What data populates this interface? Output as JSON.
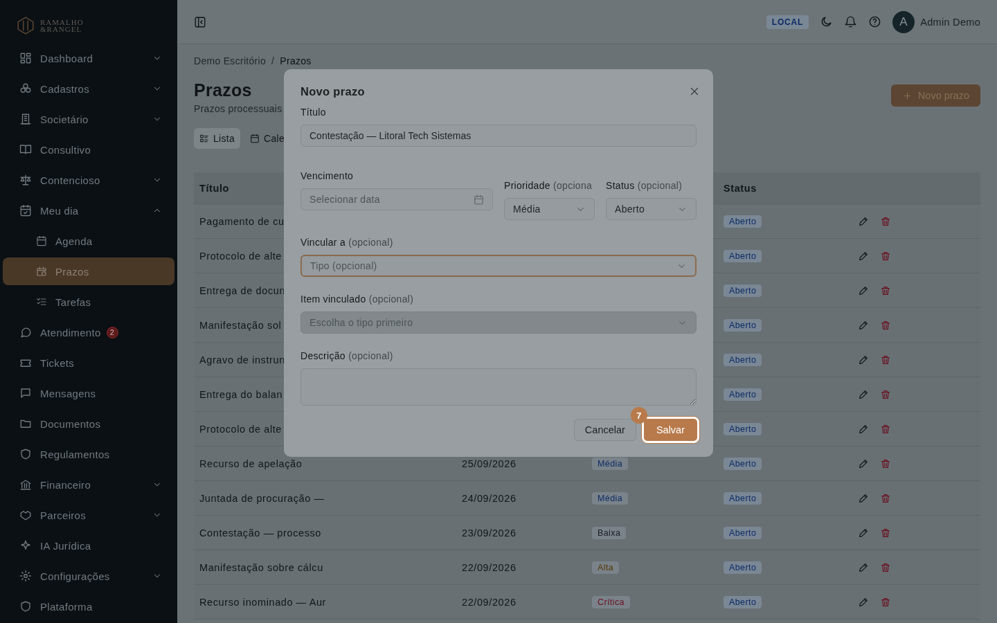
{
  "sidebar": {
    "logo": {
      "line_1": "RAMALHO",
      "line_2": "&RANGEL"
    },
    "items": [
      {
        "label": "Dashboard",
        "expandable": true,
        "expanded": false,
        "selected": false
      },
      {
        "label": "Cadastros",
        "expandable": true,
        "expanded": false,
        "selected": false
      },
      {
        "label": "Societário",
        "expandable": true,
        "expanded": false,
        "selected": false
      },
      {
        "label": "Consultivo",
        "expandable": false,
        "selected": false
      },
      {
        "label": "Contencioso",
        "expandable": true,
        "expanded": false,
        "selected": false
      },
      {
        "label": "Meu dia",
        "expandable": true,
        "expanded": true,
        "selected": false,
        "children": [
          {
            "label": "Agenda",
            "selected": false
          },
          {
            "label": "Prazos",
            "selected": true
          },
          {
            "label": "Tarefas",
            "selected": false
          }
        ]
      },
      {
        "label": "Atendimento",
        "expandable": false,
        "selected": false,
        "badge": "2"
      },
      {
        "label": "Tickets",
        "expandable": false,
        "selected": false
      },
      {
        "label": "Mensagens",
        "expandable": false,
        "selected": false
      },
      {
        "label": "Documentos",
        "expandable": false,
        "selected": false
      },
      {
        "label": "Regulamentos",
        "expandable": false,
        "selected": false
      },
      {
        "label": "Financeiro",
        "expandable": true,
        "expanded": false,
        "selected": false
      },
      {
        "label": "Parceiros",
        "expandable": true,
        "expanded": false,
        "selected": false
      },
      {
        "label": "IA Jurídica",
        "expandable": false,
        "selected": false
      },
      {
        "label": "Configurações",
        "expandable": true,
        "expanded": false,
        "selected": false
      },
      {
        "label": "Plataforma",
        "expandable": false,
        "selected": false
      }
    ]
  },
  "header": {
    "environment": "LOCAL",
    "avatar": "A",
    "user": "Admin Demo"
  },
  "breadcrumb": [
    "Demo Escritório",
    "/",
    "Prazos"
  ],
  "page": {
    "title": "Prazos",
    "subtitle": "Prazos processuais",
    "new_button": "Novo prazo"
  },
  "view_tabs": [
    {
      "label": "Lista",
      "selected": true
    },
    {
      "label": "Cale",
      "selected": false
    }
  ],
  "table": {
    "columns": [
      {
        "label": "Título"
      },
      {
        "label": "Status"
      }
    ],
    "rows": [
      {
        "title": "Pagamento de cu",
        "status": "Aberto"
      },
      {
        "title": "Protocolo de alte",
        "status": "Aberto"
      },
      {
        "title": "Entrega de docun",
        "status": "Aberto"
      },
      {
        "title": "Manifestação sol",
        "status": "Aberto"
      },
      {
        "title": "Agravo de instrun",
        "status": "Aberto"
      },
      {
        "title": "Entrega do balan",
        "status": "Aberto"
      },
      {
        "title": "Protocolo de alte",
        "status": "Aberto"
      },
      {
        "title": "Recurso de apelação",
        "date": "25/09/2026",
        "priority": {
          "label": "Média",
          "color": "#0b2a66"
        },
        "status": "Aberto"
      },
      {
        "title": "Juntada de procuração —",
        "date": "24/09/2026",
        "priority": {
          "label": "Média",
          "color": "#0b2a66"
        },
        "status": "Aberto"
      },
      {
        "title": "Contestação — processo",
        "date": "23/09/2026",
        "priority": {
          "label": "Baixa",
          "color": "#1a1e21"
        },
        "status": "Aberto"
      },
      {
        "title": "Manifestação sobre cálcu",
        "date": "22/09/2026",
        "priority": {
          "label": "Alta",
          "color": "#553606"
        },
        "status": "Aberto"
      },
      {
        "title": "Recurso inominado — Aur",
        "date": "22/09/2026",
        "priority": {
          "label": "Crítica",
          "color": "#6b0f1e"
        },
        "status": "Aberto"
      }
    ]
  },
  "modal": {
    "title": "Novo prazo",
    "title_field": {
      "label": "Título",
      "value": "Contestação — Litoral Tech Sistemas"
    },
    "due_field": {
      "label": "Vencimento",
      "placeholder": "Selecionar data"
    },
    "priority_field": {
      "label": "Prioridade",
      "hint": "(opciona",
      "value": "Média"
    },
    "status_field": {
      "label": "Status",
      "hint": "(opcional)",
      "value": "Aberto"
    },
    "link_field": {
      "label": "Vincular a",
      "hint": "(opcional)",
      "placeholder": "Tipo (opcional)",
      "focused": true,
      "disabled": false
    },
    "item_field": {
      "label": "Item vinculado",
      "hint": "(opcional)",
      "placeholder": "Escolha o tipo primeiro",
      "focused": false,
      "disabled": true
    },
    "description_field": {
      "label": "Descrição",
      "hint": "(opcional)"
    },
    "cancel_button": "Cancelar",
    "save_button": "Salvar",
    "tour_step": "7"
  }
}
